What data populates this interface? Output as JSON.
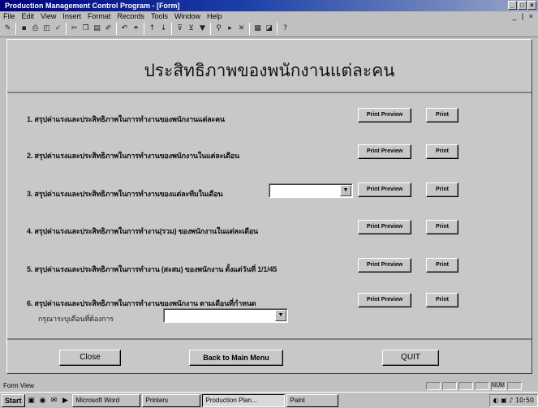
{
  "window": {
    "title": "Production Management Control Program - [Form]",
    "controls": [
      "_",
      "□",
      "×"
    ]
  },
  "menu": {
    "items": [
      "File",
      "Edit",
      "View",
      "Insert",
      "Format",
      "Records",
      "Tools",
      "Window",
      "Help"
    ],
    "doc_controls": "_ | ×"
  },
  "toolbar": {
    "icons": [
      "design-view",
      "save",
      "print",
      "print-preview",
      "spelling",
      "cut",
      "copy",
      "paste",
      "format-painter",
      "undo",
      "insert-hyperlink",
      "sort-ascending",
      "sort-descending",
      "filter-by-selection",
      "filter-by-form",
      "apply-filter",
      "find",
      "new-record",
      "delete-record",
      "database-window",
      "new-object",
      "office-assistant"
    ]
  },
  "form": {
    "title": "ประสิทธิภาพของพนักงานแต่ละคน",
    "rows": [
      {
        "label": "1. สรุปค่าแรงและประสิทธิภาพในการทำงานของพนักงานแต่ละคน",
        "preview": "Print Preview",
        "print": "Print"
      },
      {
        "label": "2. สรุปค่าแรงและประสิทธิภาพในการทำงานของพนักงานในแต่ละเดือน",
        "preview": "Print Preview",
        "print": "Print"
      },
      {
        "label": "3. สรุปค่าแรงและประสิทธิภาพในการทำงานของแต่ละทีมในเดือน",
        "preview": "Print Preview",
        "print": "Print",
        "combo_value": ""
      },
      {
        "label": "4. สรุปค่าแรงและประสิทธิภาพในการทำงาน(รวม) ของพนักงานในแต่ละเดือน",
        "preview": "Print Preview",
        "print": "Print"
      },
      {
        "label": "5. สรุปค่าแรงและประสิทธิภาพในการทำงาน (สะสม) ของพนักงาน ตั้งแต่วันที่ 1/1/45",
        "preview": "Print Preview",
        "print": "Print"
      },
      {
        "label": "6. สรุปค่าแรงและประสิทธิภาพในการทำงานของพนักงาน ตามเดือนที่กำหนด",
        "preview": "Print Preview",
        "print": "Print",
        "sub_label": "กรุณาระบุเดือนที่ต้องการ",
        "combo_value": ""
      }
    ],
    "footer": {
      "close": "Close",
      "back": "Back to Main Menu",
      "quit": "QUIT"
    }
  },
  "status": {
    "text": "Form View",
    "indicator": "NUM"
  },
  "taskbar": {
    "start": "Start",
    "tasks": [
      {
        "label": "Microsoft Word",
        "active": false
      },
      {
        "label": "Printers",
        "active": false
      },
      {
        "label": "Production Plan...",
        "active": true
      },
      {
        "label": "Paint",
        "active": false
      }
    ],
    "clock": "10:50"
  }
}
